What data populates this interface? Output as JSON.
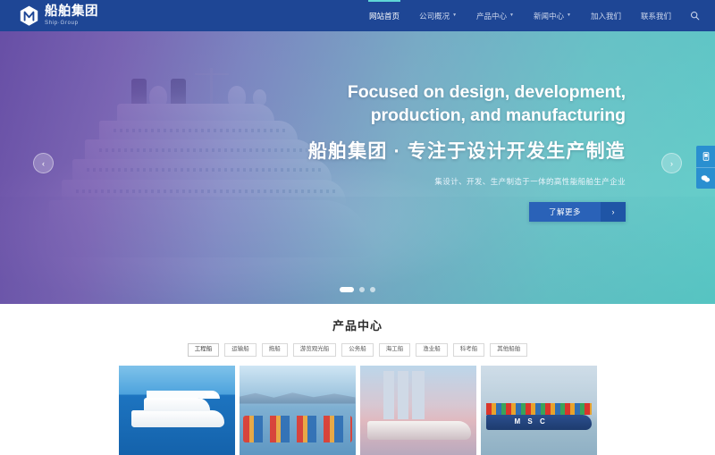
{
  "header": {
    "logo": {
      "icon": "hexagon-m-logo-icon",
      "name_cn": "船舶集团",
      "name_en": "Ship·Group"
    },
    "nav": [
      {
        "label": "网站首页",
        "has_dropdown": false,
        "active": true
      },
      {
        "label": "公司概况",
        "has_dropdown": true,
        "active": false
      },
      {
        "label": "产品中心",
        "has_dropdown": true,
        "active": false
      },
      {
        "label": "新闻中心",
        "has_dropdown": true,
        "active": false
      },
      {
        "label": "加入我们",
        "has_dropdown": false,
        "active": false
      },
      {
        "label": "联系我们",
        "has_dropdown": false,
        "active": false
      }
    ],
    "caret": "▼",
    "search_icon": "search-icon"
  },
  "hero": {
    "headline_en_line1": "Focused on design, development,",
    "headline_en_line2": "production, and manufacturing",
    "headline_cn": "船舶集团 · 专注于设计开发生产制造",
    "subtitle": "集设计、开发、生产制造于一体的高性能船舶生产企业",
    "cta_label": "了解更多",
    "cta_arrow": "›",
    "prev_arrow": "‹",
    "next_arrow": "›",
    "slides": 3,
    "active_slide": 1,
    "image_alt": "白色大型邮轮",
    "tint_from": "#5c3e9e",
    "tint_to": "#2bc5ba"
  },
  "side_rail": [
    {
      "icon": "phone-icon",
      "glyph": "✆"
    },
    {
      "icon": "wechat-icon",
      "glyph": "💬"
    }
  ],
  "products": {
    "title": "产品中心",
    "tabs": [
      {
        "label": "工程船",
        "active": true
      },
      {
        "label": "运输船",
        "active": false
      },
      {
        "label": "拖船",
        "active": false
      },
      {
        "label": "游览观光船",
        "active": false
      },
      {
        "label": "公务船",
        "active": false
      },
      {
        "label": "海工船",
        "active": false
      },
      {
        "label": "渔业船",
        "active": false
      },
      {
        "label": "科考船",
        "active": false
      },
      {
        "label": "其他船舶",
        "active": false
      }
    ],
    "cards": [
      {
        "art": "art-yacht",
        "alt": "白色豪华游艇"
      },
      {
        "art": "art-pedal",
        "alt": "码头彩色脚踏船"
      },
      {
        "art": "art-sail",
        "alt": "三桅现代帆船"
      },
      {
        "art": "art-msc",
        "alt": "MSC 集装箱货轮",
        "mark": "M S C"
      }
    ]
  }
}
